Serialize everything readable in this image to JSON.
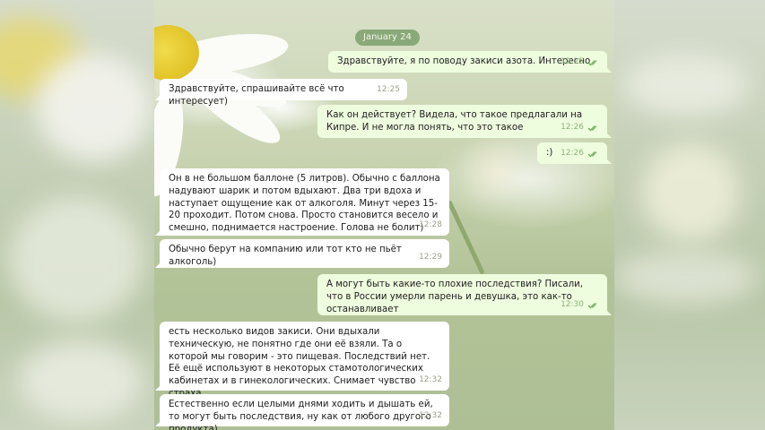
{
  "chat": {
    "date_label": "January 24",
    "messages": [
      {
        "dir": "out",
        "text": "Здравствуйте, я по поводу закиси азота. Интересно",
        "time": "12:25",
        "read": true
      },
      {
        "dir": "in",
        "text": "Здравствуйте, спрашивайте всё что интересует)",
        "time": "12:25"
      },
      {
        "dir": "out",
        "text": "Как он действует? Видела, что такое предлагали на Кипре. И не могла понять, что это такое",
        "time": "12:26",
        "read": true
      },
      {
        "dir": "out",
        "text": ":)",
        "time": "12:26",
        "read": true
      },
      {
        "dir": "in",
        "text": "Он в не большом баллоне (5 литров). Обычно с баллона надувают шарик и потом вдыхают. Два три вдоха и наступает ощущение как от алкоголя. Минут через 15-20 проходит. Потом снова. Просто становится весело и смешно, поднимается настроение. Голова не болит)",
        "time": "12:28"
      },
      {
        "dir": "in",
        "text": "Обычно берут на компанию или тот кто не пьёт алкоголь)",
        "time": "12:29"
      },
      {
        "dir": "out",
        "text": "А могут быть какие-то плохие последствия? Писали, что в России умерли парень и девушка, это как-то останавливает",
        "time": "12:30",
        "read": true
      },
      {
        "dir": "in",
        "text": "есть несколько видов закиси. Они вдыхали техническую, не понятно где они её взяли. Та о которой мы говорим - это пищевая. Последствий нет. Её ещё используют в некоторых стамотологических кабинетах и в гинекологических. Снимает чувство страха.",
        "time": "12:32"
      },
      {
        "dir": "in",
        "text": "Естественно если целыми днями ходить и дышать ей, то могут быть последствия, ну как от любого другого продукта)",
        "time": "12:32"
      }
    ]
  },
  "colors": {
    "incoming_bubble": "#ffffff",
    "outgoing_bubble": "#effddf",
    "date_pill": "#8aa978",
    "check_color": "#6fae5c"
  }
}
